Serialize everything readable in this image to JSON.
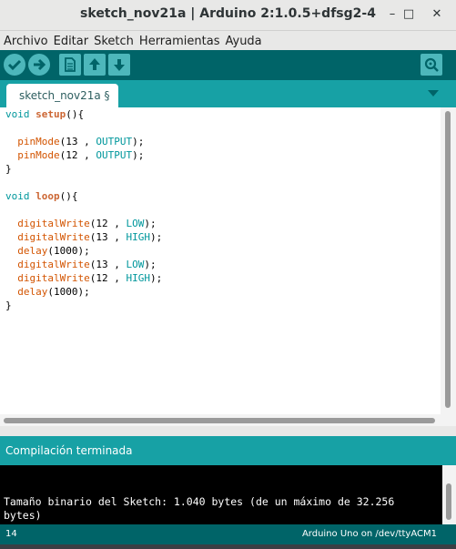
{
  "window": {
    "title": "sketch_nov21a | Arduino 2:1.0.5+dfsg2-4",
    "controls": [
      "–",
      "□",
      "✕"
    ]
  },
  "menu": {
    "items": [
      "Archivo",
      "Editar",
      "Sketch",
      "Herramientas",
      "Ayuda"
    ]
  },
  "toolbar": {
    "buttons": [
      "verify-icon",
      "upload-icon",
      "new-icon",
      "open-icon",
      "save-icon",
      "serial-monitor-icon"
    ]
  },
  "tab": {
    "label": "sketch_nov21a §"
  },
  "code": {
    "lines": [
      "void setup(){",
      "",
      "  pinMode(13 , OUTPUT);",
      "  pinMode(12 , OUTPUT);",
      "}",
      "",
      "void loop(){",
      "",
      "  digitalWrite(12 , LOW);",
      "  digitalWrite(13 , HIGH);",
      "  delay(1000);",
      "  digitalWrite(13 , LOW);",
      "  digitalWrite(12 , HIGH);",
      "  delay(1000);",
      "}"
    ]
  },
  "status": {
    "message": "Compilación terminada"
  },
  "console": {
    "lines": [
      "Tamaño binario del Sketch: 1.040 bytes (de un máximo de 32.256",
      "bytes)"
    ]
  },
  "footer": {
    "line_number": "14",
    "board_port": "Arduino Uno on /dev/ttyACM1"
  },
  "colors": {
    "toolbar": "#006468",
    "tabbar": "#17a1a5",
    "button": "#4db7bb"
  }
}
